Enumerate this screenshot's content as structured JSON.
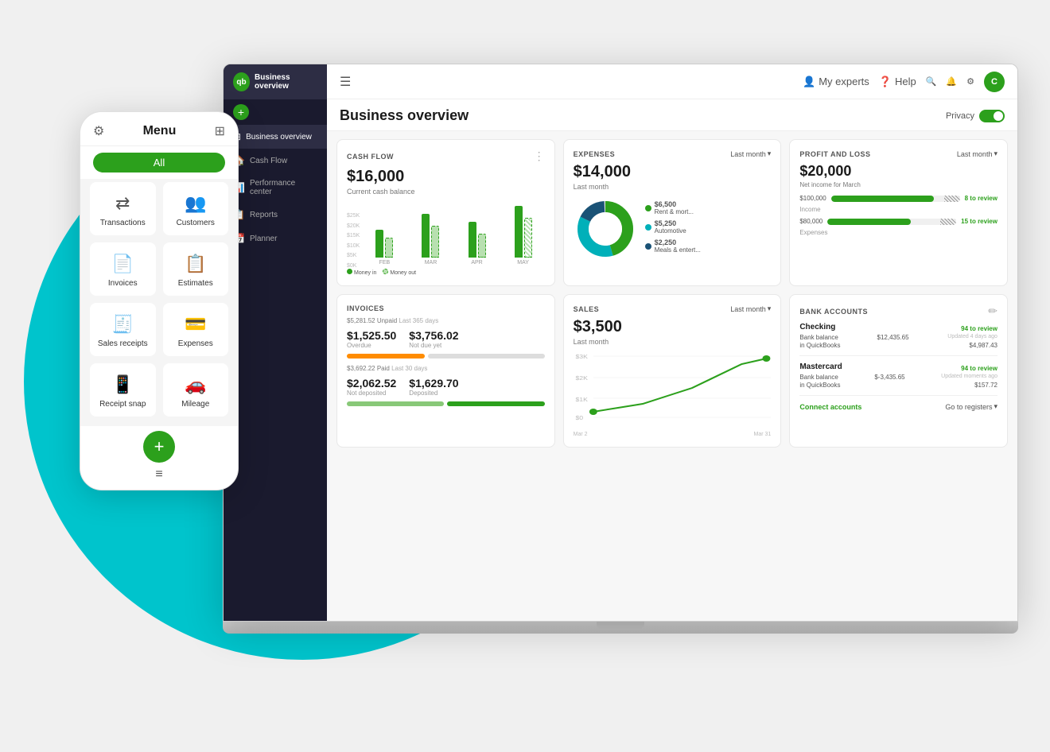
{
  "background": "#f0f0f0",
  "teal_circle": "#00C4CC",
  "phone": {
    "menu_title": "Menu",
    "all_label": "All",
    "grid_items": [
      {
        "label": "Transactions",
        "icon": "⇄"
      },
      {
        "label": "Customers",
        "icon": "👥"
      },
      {
        "label": "Invoices",
        "icon": "📄"
      },
      {
        "label": "Estimates",
        "icon": "📋"
      },
      {
        "label": "Sales receipts",
        "icon": "🧾"
      },
      {
        "label": "Expenses",
        "icon": "💳"
      },
      {
        "label": "Receipt snap",
        "icon": "📱"
      },
      {
        "label": "Mileage",
        "icon": "🚗"
      }
    ],
    "fab_icon": "+",
    "hamburger_icon": "≡"
  },
  "sidebar": {
    "logo_text": "qb",
    "app_name": "Business overview",
    "nav_items": [
      {
        "label": "Business overview",
        "icon": "⊞",
        "active": true
      },
      {
        "label": "Cash Flow",
        "icon": "🏠"
      },
      {
        "label": "Performance center",
        "icon": "📊"
      },
      {
        "label": "Reports",
        "icon": "📋"
      },
      {
        "label": "Planner",
        "icon": "📅"
      }
    ]
  },
  "topbar": {
    "hamburger": "☰",
    "my_experts": "My experts",
    "help": "Help",
    "user_initial": "C"
  },
  "page": {
    "title": "Business overview",
    "privacy_label": "Privacy"
  },
  "cards": {
    "cash_flow": {
      "title": "CASH FLOW",
      "amount": "$16,000",
      "subtitle": "Current cash balance",
      "y_labels": [
        "$25K",
        "$20K",
        "$15K",
        "$10K",
        "$5K",
        "$0K"
      ],
      "bars": [
        {
          "month": "FEB",
          "in_h": 35,
          "out_h": 25
        },
        {
          "month": "MAR",
          "in_h": 55,
          "out_h": 40
        },
        {
          "month": "APR",
          "in_h": 45,
          "out_h": 30
        },
        {
          "month": "MAY",
          "in_h": 65,
          "out_h": 50
        }
      ],
      "legend_in": "Money in",
      "legend_out": "Money out"
    },
    "expenses": {
      "title": "EXPENSES",
      "period": "Last month",
      "amount": "$14,000",
      "subtitle": "Last month",
      "items": [
        {
          "label": "Rent & mort...",
          "value": "$6,500",
          "color": "#2ca01c",
          "pct": 46
        },
        {
          "label": "Automotive",
          "value": "$5,250",
          "color": "#00b0b9",
          "pct": 37
        },
        {
          "label": "Meals & entert...",
          "value": "$2,250",
          "color": "#1a5276",
          "pct": 17
        }
      ]
    },
    "profit_loss": {
      "title": "PROFIT AND LOSS",
      "period": "Last month",
      "amount": "$20,000",
      "subtitle": "Net income for March",
      "income_label": "Income",
      "income_value": "$100,000",
      "income_review": "8 to review",
      "expenses_label": "Expenses",
      "expenses_value": "$80,000",
      "expenses_review": "15 to review"
    },
    "invoices": {
      "title": "INVOICES",
      "unpaid_label": "$5,281.52 Unpaid",
      "unpaid_period": "Last 365 days",
      "overdue_val": "$1,525.50",
      "overdue_label": "Overdue",
      "not_due_val": "$3,756.02",
      "not_due_label": "Not due yet",
      "paid_label": "$3,692.22 Paid",
      "paid_period": "Last 30 days",
      "not_deposited_val": "$2,062.52",
      "not_deposited_label": "Not deposited",
      "deposited_val": "$1,629.70",
      "deposited_label": "Deposited"
    },
    "sales": {
      "title": "SALES",
      "period": "Last month",
      "amount": "$3,500",
      "subtitle": "Last month",
      "date_start": "Mar 2",
      "date_end": "Mar 31",
      "y_labels": [
        "$3K",
        "$2K",
        "$1K",
        "$0"
      ]
    },
    "bank_accounts": {
      "title": "BANK ACCOUNTS",
      "edit_icon": "✏️",
      "checking_name": "Checking",
      "checking_review": "94 to review",
      "checking_bank_balance": "$12,435.65",
      "checking_qb": "$4,987.43",
      "checking_updated": "Updated 4 days ago",
      "mastercard_name": "Mastercard",
      "mastercard_review": "94 to review",
      "mastercard_bank_balance": "$-3,435.65",
      "mastercard_qb": "$157.72",
      "mastercard_updated": "Updated moments ago",
      "connect_label": "Connect accounts",
      "registers_label": "Go to registers"
    }
  }
}
